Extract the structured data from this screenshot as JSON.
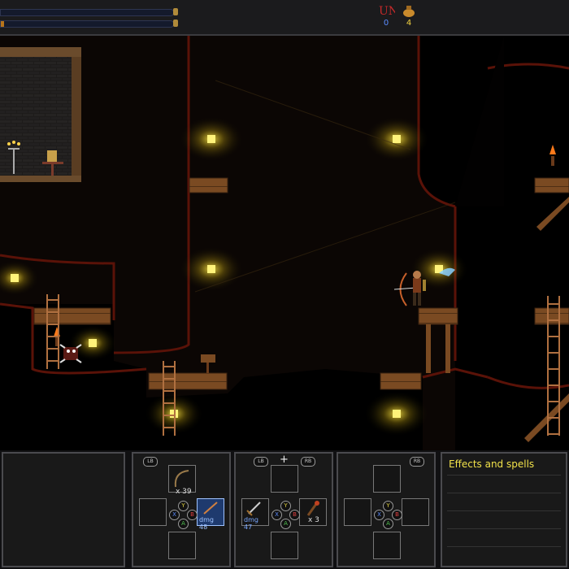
{
  "top": {
    "counter_left_value": "0",
    "counter_right_value": "4",
    "colors": {
      "health": "#5a1a14",
      "mana": "#b8741a",
      "frame": "#3b3b3e"
    }
  },
  "hud": {
    "left_item_count": "x 39",
    "left_item_dmg": "dmg 48",
    "mid_left_dmg": "dmg 47",
    "mid_right_count": "x 3",
    "effects_title": "Effects and spells",
    "labels": {
      "lb": "LB",
      "rb": "RB",
      "plus": "+",
      "x": "X",
      "y": "Y",
      "a": "A",
      "b": "B"
    }
  }
}
